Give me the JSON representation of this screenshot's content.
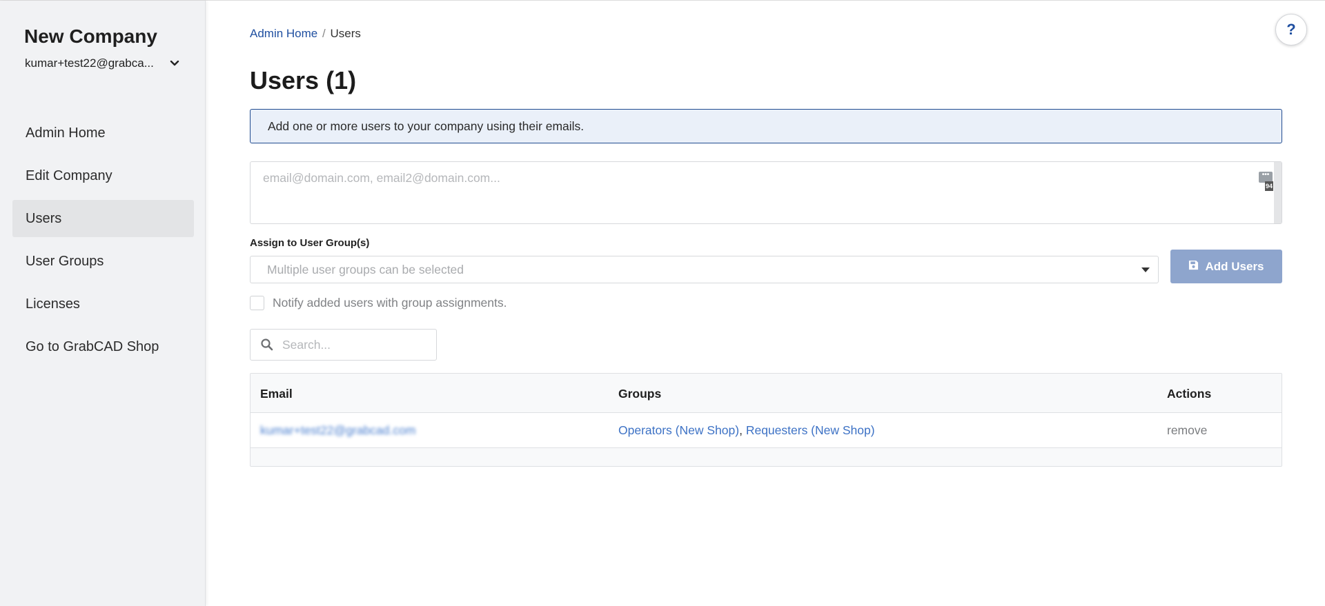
{
  "sidebar": {
    "company_name": "New Company",
    "account_email": "kumar+test22@grabca...",
    "items": [
      {
        "label": "Admin Home",
        "active": false
      },
      {
        "label": "Edit Company",
        "active": false
      },
      {
        "label": "Users",
        "active": true
      },
      {
        "label": "User Groups",
        "active": false
      },
      {
        "label": "Licenses",
        "active": false
      },
      {
        "label": "Go to GrabCAD Shop",
        "active": false
      }
    ]
  },
  "header": {
    "breadcrumb": {
      "parent": "Admin Home",
      "separator": "/",
      "current": "Users"
    },
    "title": "Users (1)",
    "help_label": "?"
  },
  "add_users": {
    "info_text": "Add one or more users to your company using their emails.",
    "emails_placeholder": "email@domain.com, email2@domain.com...",
    "extension_badge_top": "•••",
    "extension_badge_bottom": "94",
    "group_label": "Assign to User Group(s)",
    "group_placeholder": "Multiple user groups can be selected",
    "add_button_label": "Add Users",
    "notify_label": "Notify added users with group assignments."
  },
  "search": {
    "placeholder": "Search..."
  },
  "table": {
    "columns": {
      "email": "Email",
      "groups": "Groups",
      "actions": "Actions"
    },
    "rows": [
      {
        "email": "kumar+test22@grabcad.com",
        "groups": [
          "Operators (New Shop)",
          "Requesters (New Shop)"
        ],
        "group_separator": ",",
        "action": "remove"
      }
    ]
  },
  "colors": {
    "accent": "#1f4fa0",
    "button_disabled": "#8ea5cd",
    "info_bg": "#eaf0f9",
    "sidebar_bg": "#f1f2f4"
  }
}
